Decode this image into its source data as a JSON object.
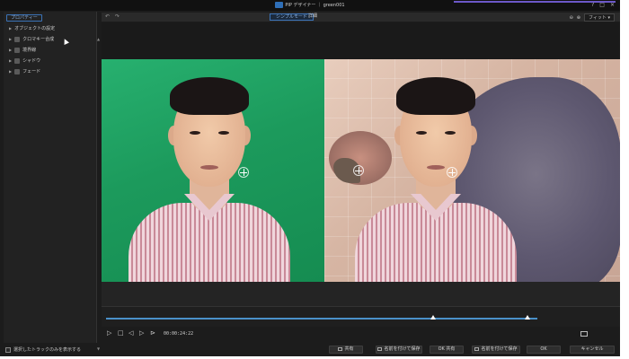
{
  "window": {
    "title": "PIP デザイナー ｜ green001",
    "controls": [
      "?",
      "□",
      "×"
    ]
  },
  "sidebar": {
    "tab_label": "プロパティー",
    "items": [
      {
        "label": "オブジェクトの設定",
        "has_checkbox": false
      },
      {
        "label": "クロマキー合成",
        "has_checkbox": true
      },
      {
        "label": "境界線",
        "has_checkbox": true
      },
      {
        "label": "シャドウ",
        "has_checkbox": true
      },
      {
        "label": "フェード",
        "has_checkbox": true
      }
    ],
    "only_track_label": "選択したトラックのみを表示する"
  },
  "toolbar": {
    "mode_tab_active": "シンプルモード",
    "mode_tab_inactive": "詳細",
    "zoom_value": "フィット"
  },
  "timeline": {
    "timecode": "00:00:24:22"
  },
  "footer": {
    "buttons": [
      "共有",
      "名前を付けて保存",
      "OK 共有",
      "名前を付けて保存",
      "OK",
      "キャンセル"
    ]
  },
  "colors": {
    "accent": "#3b73b8",
    "green_screen": "#1c9a5c",
    "timeline_track": "#4a90c8"
  }
}
